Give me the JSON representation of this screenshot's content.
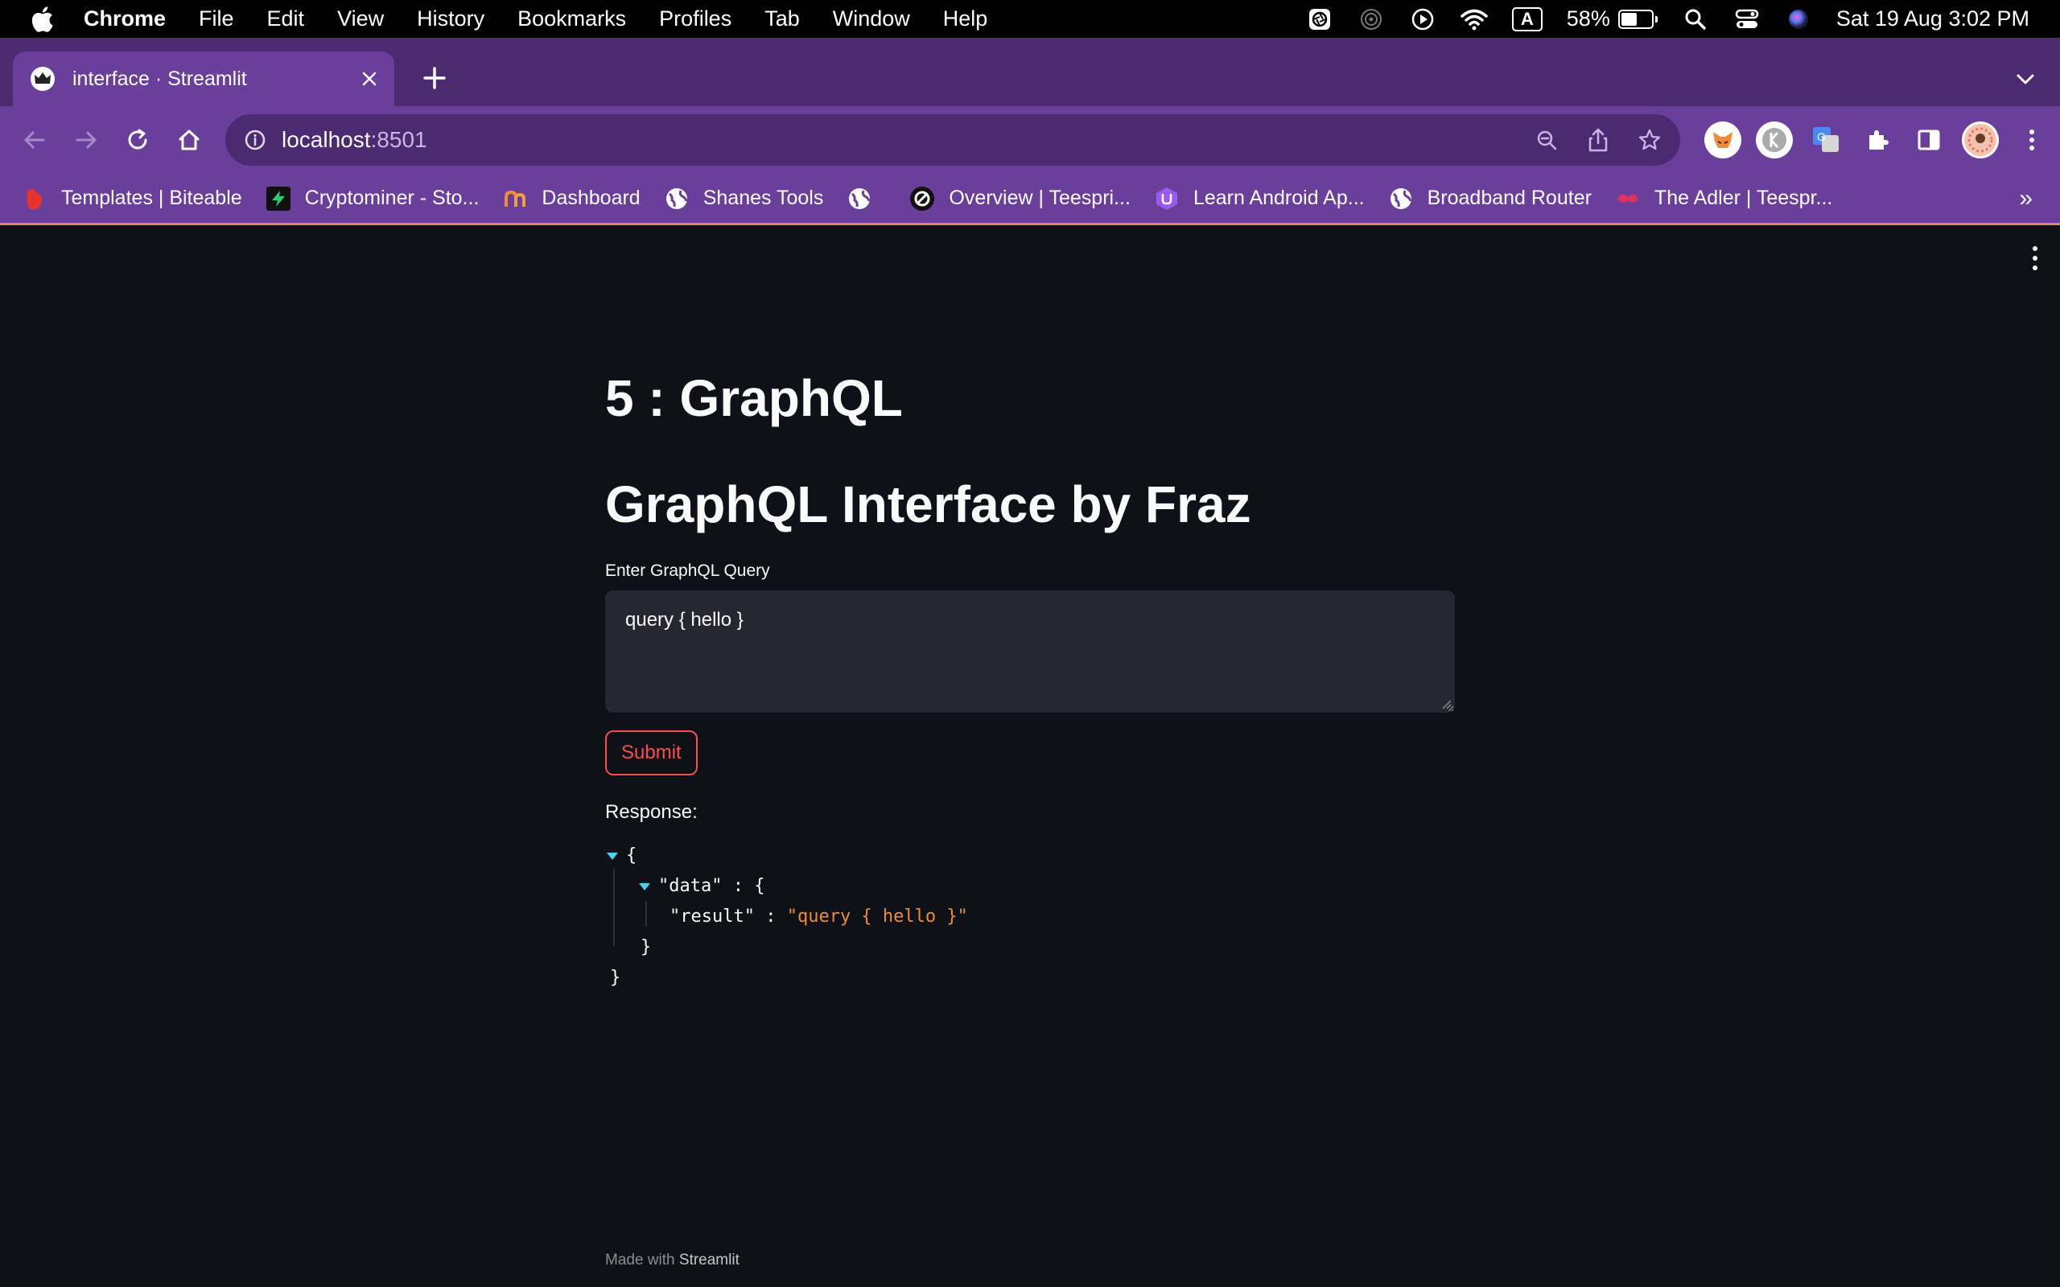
{
  "menubar": {
    "app": "Chrome",
    "menus": [
      "File",
      "Edit",
      "View",
      "History",
      "Bookmarks",
      "Profiles",
      "Tab",
      "Window",
      "Help"
    ],
    "battery_percent": "58%",
    "battery_level": 0.58,
    "keyboard_indicator": "A",
    "datetime": "Sat 19 Aug  3:02 PM"
  },
  "browser": {
    "tab_title": "interface · Streamlit",
    "url_host": "localhost",
    "url_port": ":8501",
    "bookmarks": [
      {
        "label": "Templates | Biteable",
        "icon": "biteable-icon",
        "color": "#e8322c"
      },
      {
        "label": "Cryptominer - Sto...",
        "icon": "cryptominer-icon",
        "color": "#2ecc71"
      },
      {
        "label": "Dashboard",
        "icon": "dashboard-icon",
        "color": "#f28b36"
      },
      {
        "label": "Shanes Tools",
        "icon": "globe-icon",
        "color": "#ffffff"
      },
      {
        "label": "",
        "icon": "globe-icon",
        "color": "#ffffff"
      },
      {
        "label": "Overview | Teespri...",
        "icon": "teespring-icon",
        "color": "#111111"
      },
      {
        "label": "Learn Android Ap...",
        "icon": "udacity-icon",
        "color": "#9b59f0"
      },
      {
        "label": "Broadband Router",
        "icon": "globe-icon",
        "color": "#ffffff"
      },
      {
        "label": "The Adler | Teespr...",
        "icon": "adler-icon",
        "color": "#e0325a"
      }
    ],
    "bookmarks_more": "»"
  },
  "page": {
    "title": "5 : GraphQL",
    "subtitle": "GraphQL Interface by Fraz",
    "query_label": "Enter GraphQL Query",
    "query_value": "query { hello }",
    "submit_label": "Submit",
    "response_label": "Response:",
    "response_json": {
      "open_brace": "{",
      "data_key": "\"data\"",
      "colon": ":",
      "data_open": "{",
      "result_key": "\"result\"",
      "result_value": "\"query { hello }\"",
      "data_close": "}",
      "close_brace": "}"
    },
    "footer_prefix": "Made with",
    "footer_brand": "Streamlit"
  },
  "colors": {
    "accent": "#ff4b4b",
    "json_string": "#f28b36",
    "json_caret": "#4fd0e8",
    "chrome_frame": "#6a3f9b"
  }
}
